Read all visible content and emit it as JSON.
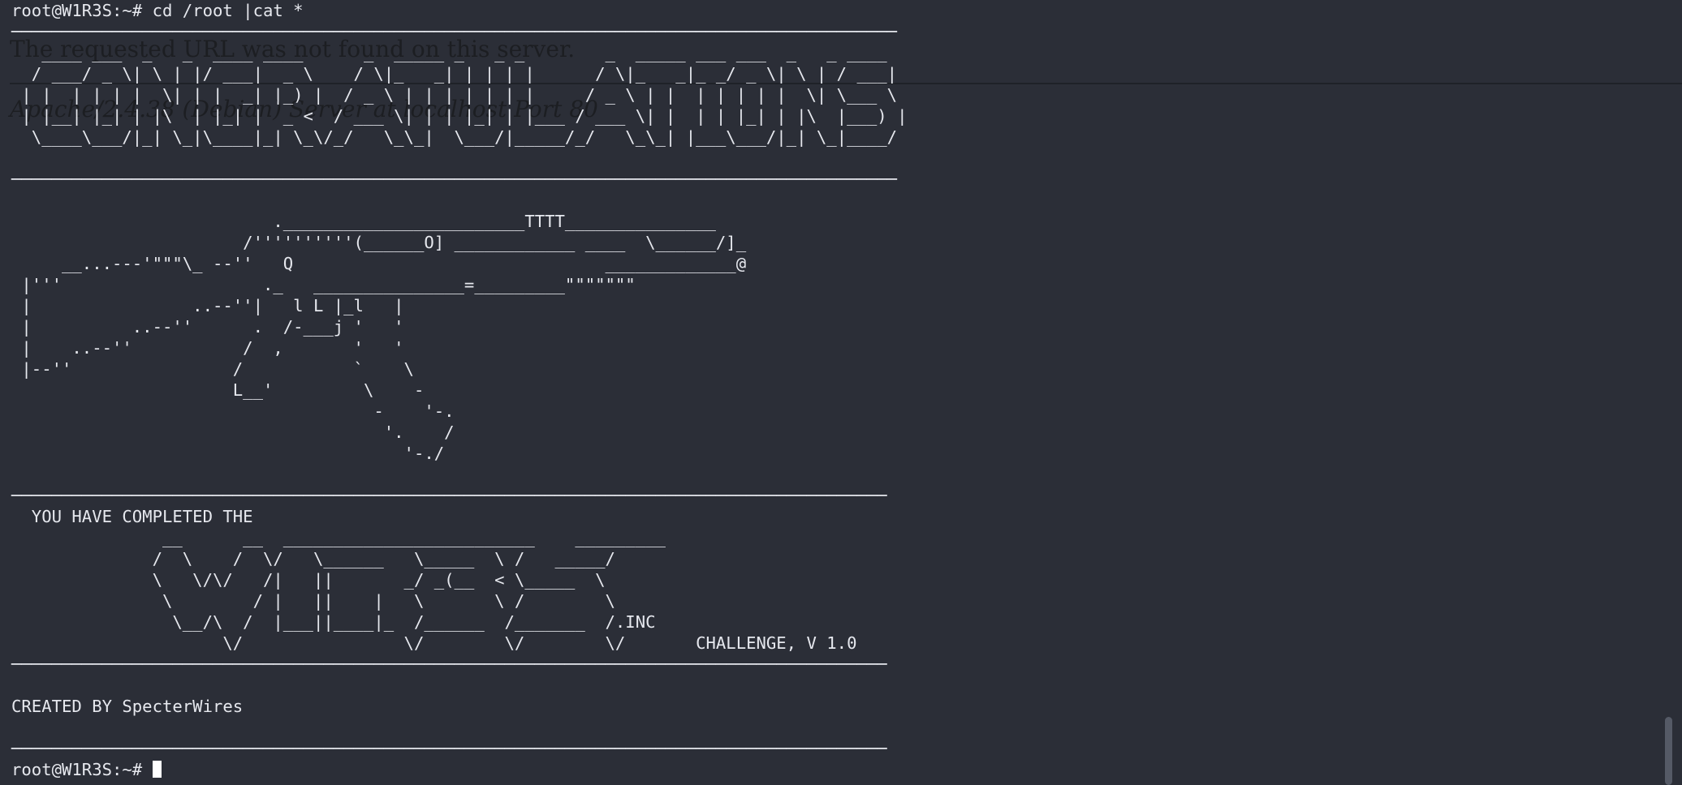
{
  "overlay": {
    "error_message": "The requested URL was not found on this server.",
    "server_address": "Apache/2.4.38 (Debian) Server at localhost Port 80"
  },
  "terminal": {
    "cursor_color": "#ffffff",
    "background": "#2b2e37",
    "foreground": "#e6e8ee",
    "lines": [
      "root@W1R3S:~# cd /root |cat *",
      "────────────────────────────────────────────────────────────────────────────────────────",
      "   ____ ___  _   _  ____ ____      _  _____ _   _ _        _  _____ ___ ___  _   _ ____",
      "  / ___/ _ \\| \\ | |/ ___|  _ \\    / \\|_   _| | | | |      / \\|_   _|_ _/ _ \\| \\ | / ___|",
      " | |  | | | |  \\| | |  _| |_) |  / _ \\ | | | | | | |     / _ \\ | |  | | | | |  \\| \\___ \\",
      " | |__| |_| | |\\  | |_| |  _ <  / ___ \\| | | |_| | |___ / ___ \\| |  | | |_| | |\\  |___) |",
      "  \\____\\___/|_| \\_|\\____|_| \\_\\/_/   \\_\\_|  \\___/|_____/_/   \\_\\_| |___\\___/|_| \\_|____/",
      "",
      "────────────────────────────────────────────────────────────────────────────────────────",
      "",
      "                          .________________________TTTT_______________",
      "                       /''''''''''(______O] ____________ ____  \\______/]_",
      "     __...---'\"\"\"\\_ --''   Q                               _____________@",
      " |'''                    ._   _______________=_________\"\"\"\"\"\"\"",
      " |                ..--''|   l L |_l   |",
      " |          ..--''      .  /-___j '   '",
      " |    ..--''           /  ,       '   '",
      " |--''                /           `    \\",
      "                      L__'         \\    -",
      "                                    -    '-.",
      "                                     '.    /",
      "                                       '-./",
      "",
      "───────────────────────────────────────────────────────────────────────────────────────",
      "  YOU HAVE COMPLETED THE",
      "               __      __  _________________________    _________",
      "              /  \\    /  \\/   \\______   \\_____  \\ /   _____/",
      "              \\   \\/\\/   /|   ||       _/ _(__  < \\_____  \\",
      "               \\        / |   ||    |   \\       \\ /        \\",
      "                \\__/\\  /  |___||____|_  /______  /_______  /.INC",
      "                     \\/                \\/        \\/        \\/       CHALLENGE, V 1.0",
      "───────────────────────────────────────────────────────────────────────────────────────",
      "",
      "CREATED BY SpecterWires",
      "",
      "───────────────────────────────────────────────────────────────────────────────────────"
    ],
    "prompt": "root@W1R3S:~# "
  }
}
